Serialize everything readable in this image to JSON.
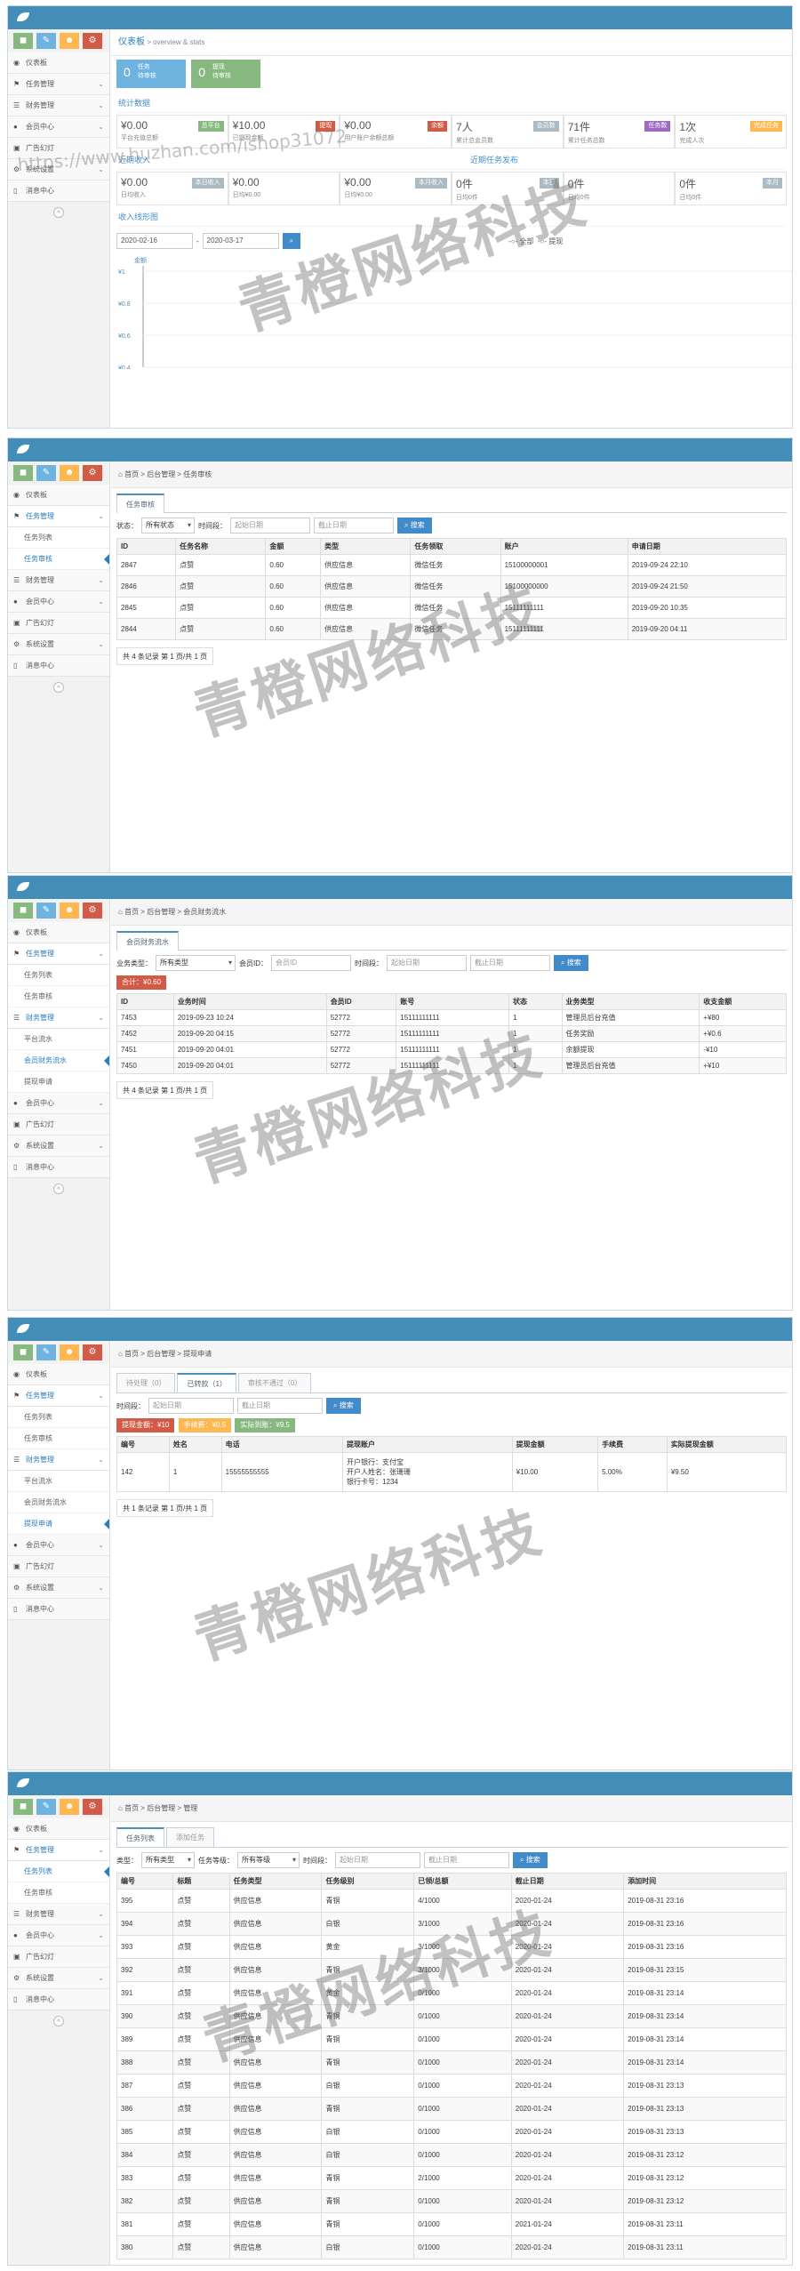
{
  "common": {
    "nav": {
      "dashboard": "仪表板",
      "task_mgmt": "任务管理",
      "task_list": "任务列表",
      "task_review": "任务审核",
      "finance": "财务管理",
      "platform_flow": "平台流水",
      "member_flow": "会员财务流水",
      "withdraw": "提现申请",
      "member_center": "会员中心",
      "ads": "广告幻灯",
      "settings": "系统设置",
      "messages": "消息中心"
    },
    "watermark": "青橙网络科技",
    "watermark_url": "https://www.huzhan.com/ishop31072"
  },
  "s1": {
    "crumb_title": "仪表板",
    "crumb_sub": "> overview & stats",
    "box1": {
      "num": "0",
      "l1": "任务",
      "l2": "待审核"
    },
    "box2": {
      "num": "0",
      "l1": "提现",
      "l2": "待审核"
    },
    "stats_title": "统计数据",
    "stats": [
      {
        "v": "¥0.00",
        "c": "平台充值总额",
        "tag": "总平台"
      },
      {
        "v": "¥10.00",
        "c": "已提现金额",
        "tag": "提现"
      },
      {
        "v": "¥0.00",
        "c": "用户账户余额总额",
        "tag": "余额"
      },
      {
        "v": "7人",
        "c": "累计总会员数",
        "tag": "会员数"
      },
      {
        "v": "71件",
        "c": "累计任务总数",
        "tag": "任务数"
      },
      {
        "v": "1次",
        "c": "完成人次",
        "tag": "完成任务"
      }
    ],
    "recent_title": "近期收入",
    "recent_title2": "近期任务发布",
    "recent": [
      {
        "v": "¥0.00",
        "c": "日均收入",
        "tag": "本日收入"
      },
      {
        "v": "¥0.00",
        "c": "日均¥0.00",
        "tag": ""
      },
      {
        "v": "¥0.00",
        "c": "日均¥0.00",
        "tag": "本月收入"
      },
      {
        "v": "0件",
        "c": "日均0件",
        "tag": "本日"
      },
      {
        "v": "0件",
        "c": "日均0件",
        "tag": ""
      },
      {
        "v": "0件",
        "c": "日均0件",
        "tag": "本月"
      }
    ],
    "trend_title": "收入线形图",
    "date_from": "2020-02-16",
    "date_to": "2020-03-17",
    "legend_all": "全部",
    "legend_withdraw": "提现"
  },
  "chart_data": {
    "type": "line",
    "title": "收入线形图",
    "ylabel": "金额",
    "xlabel": "",
    "yticks": [
      "¥1",
      "¥0.8",
      "¥0.6",
      "¥0.4"
    ],
    "series": [
      {
        "name": "全部",
        "values": []
      },
      {
        "name": "提现",
        "values": []
      }
    ],
    "legend_placement": "top-right"
  },
  "s2": {
    "crumb": "首页 > 后台管理 > 任务审核",
    "tab": "任务审核",
    "status_label": "状态：",
    "status_value": "所有状态",
    "time_label": "时间段：",
    "start_ph": "起始日期",
    "end_ph": "截止日期",
    "search": "搜索",
    "headers": [
      "ID",
      "任务名称",
      "金额",
      "类型",
      "任务领取",
      "账户",
      "申请日期"
    ],
    "rows": [
      [
        "2847",
        "点赞",
        "0.60",
        "供应信息",
        "微信任务",
        "15100000001",
        "2019-09-24 22:10"
      ],
      [
        "2846",
        "点赞",
        "0.60",
        "供应信息",
        "微信任务",
        "15100000000",
        "2019-09-24 21:50"
      ],
      [
        "2845",
        "点赞",
        "0.60",
        "供应信息",
        "微信任务",
        "15111111111",
        "2019-09-20 10:35"
      ],
      [
        "2844",
        "点赞",
        "0.60",
        "供应信息",
        "微信任务",
        "15111111111",
        "2019-09-20 04:11"
      ]
    ],
    "pager": "共 4 条记录 第 1 页/共 1 页"
  },
  "s3": {
    "crumb": "首页 > 后台管理 > 会员财务流水",
    "tab": "会员财务流水",
    "type_label": "业务类型：",
    "type_value": "所有类型",
    "member_label": "会员ID：",
    "member_ph": "会员ID",
    "time_label": "时间段：",
    "start_ph": "起始日期",
    "end_ph": "截止日期",
    "search": "搜索",
    "total": "合计：¥0.60",
    "headers": [
      "ID",
      "业务时间",
      "会员ID",
      "账号",
      "状态",
      "业务类型",
      "收支金额"
    ],
    "rows": [
      [
        "7453",
        "2019-09-23 10:24",
        "52772",
        "15111111111",
        "1",
        "管理员后台充值",
        "+¥80"
      ],
      [
        "7452",
        "2019-09-20 04:15",
        "52772",
        "15111111111",
        "1",
        "任务奖励",
        "+¥0.6"
      ],
      [
        "7451",
        "2019-09-20 04:01",
        "52772",
        "15111111111",
        "1",
        "余额提现",
        "-¥10"
      ],
      [
        "7450",
        "2019-09-20 04:01",
        "52772",
        "15111111111",
        "1",
        "管理员后台充值",
        "+¥10"
      ]
    ],
    "pager": "共 4 条记录 第 1 页/共 1 页"
  },
  "s4": {
    "crumb": "首页 > 后台管理 > 提现申请",
    "tabs": [
      "待处理（0）",
      "已转款（1）",
      "审核不通过（0）"
    ],
    "time_label": "时间段：",
    "start_ph": "起始日期",
    "end_ph": "截止日期",
    "search": "搜索",
    "badges": [
      "提现金额：¥10",
      "手续费：¥0.5",
      "实际到账：¥9.5"
    ],
    "headers": [
      "编号",
      "姓名",
      "电话",
      "提现账户",
      "提现金额",
      "手续费",
      "实际提现金额"
    ],
    "row": {
      "id": "142",
      "name": "1",
      "phone": "15555555555",
      "acc1": "开户银行：支付宝",
      "acc2": "开户人姓名：张珊珊",
      "acc3": "银行卡号：1234",
      "amount": "¥10.00",
      "fee": "5.00%",
      "actual": "¥9.50"
    },
    "pager": "共 1 条记录 第 1 页/共 1 页"
  },
  "s5": {
    "crumb": "首页 > 后台管理 > 管理",
    "tabs": [
      "任务列表",
      "添加任务"
    ],
    "type_label": "类型：",
    "type_value": "所有类型",
    "grade_label": "任务等级：",
    "grade_value": "所有等级",
    "time_label": "时间段：",
    "start_ph": "起始日期",
    "end_ph": "截止日期",
    "search": "搜索",
    "headers": [
      "编号",
      "标题",
      "任务类型",
      "任务级别",
      "已领/总额",
      "截止日期",
      "添加时间"
    ],
    "rows": [
      [
        "395",
        "点赞",
        "供应信息",
        "青铜",
        "4/1000",
        "2020-01-24",
        "2019-08-31 23:16"
      ],
      [
        "394",
        "点赞",
        "供应信息",
        "白银",
        "3/1000",
        "2020-01-24",
        "2019-08-31 23:16"
      ],
      [
        "393",
        "点赞",
        "供应信息",
        "黄金",
        "3/1000",
        "2020-01-24",
        "2019-08-31 23:16"
      ],
      [
        "392",
        "点赞",
        "供应信息",
        "青铜",
        "3/1000",
        "2020-01-24",
        "2019-08-31 23:15"
      ],
      [
        "391",
        "点赞",
        "供应信息",
        "黄金",
        "0/1000",
        "2020-01-24",
        "2019-08-31 23:14"
      ],
      [
        "390",
        "点赞",
        "供应信息",
        "青铜",
        "0/1000",
        "2020-01-24",
        "2019-08-31 23:14"
      ],
      [
        "389",
        "点赞",
        "供应信息",
        "青铜",
        "0/1000",
        "2020-01-24",
        "2019-08-31 23:14"
      ],
      [
        "388",
        "点赞",
        "供应信息",
        "青铜",
        "0/1000",
        "2020-01-24",
        "2019-08-31 23:14"
      ],
      [
        "387",
        "点赞",
        "供应信息",
        "白银",
        "0/1000",
        "2020-01-24",
        "2019-08-31 23:13"
      ],
      [
        "386",
        "点赞",
        "供应信息",
        "青铜",
        "0/1000",
        "2020-01-24",
        "2019-08-31 23:13"
      ],
      [
        "385",
        "点赞",
        "供应信息",
        "白银",
        "0/1000",
        "2020-01-24",
        "2019-08-31 23:13"
      ],
      [
        "384",
        "点赞",
        "供应信息",
        "白银",
        "0/1000",
        "2020-01-24",
        "2019-08-31 23:12"
      ],
      [
        "383",
        "点赞",
        "供应信息",
        "青铜",
        "2/1000",
        "2020-01-24",
        "2019-08-31 23:12"
      ],
      [
        "382",
        "点赞",
        "供应信息",
        "青铜",
        "0/1000",
        "2020-01-24",
        "2019-08-31 23:12"
      ],
      [
        "381",
        "点赞",
        "供应信息",
        "青铜",
        "0/1000",
        "2021-01-24",
        "2019-08-31 23:11"
      ],
      [
        "380",
        "点赞",
        "供应信息",
        "白银",
        "0/1000",
        "2020-01-24",
        "2019-08-31 23:11"
      ]
    ]
  },
  "colors": {
    "topbar": "#438eb9",
    "accent": "#2b7dbc",
    "green": "#87b87f",
    "blue": "#6fb3e0",
    "orange": "#ffb752",
    "red": "#d15b47"
  }
}
